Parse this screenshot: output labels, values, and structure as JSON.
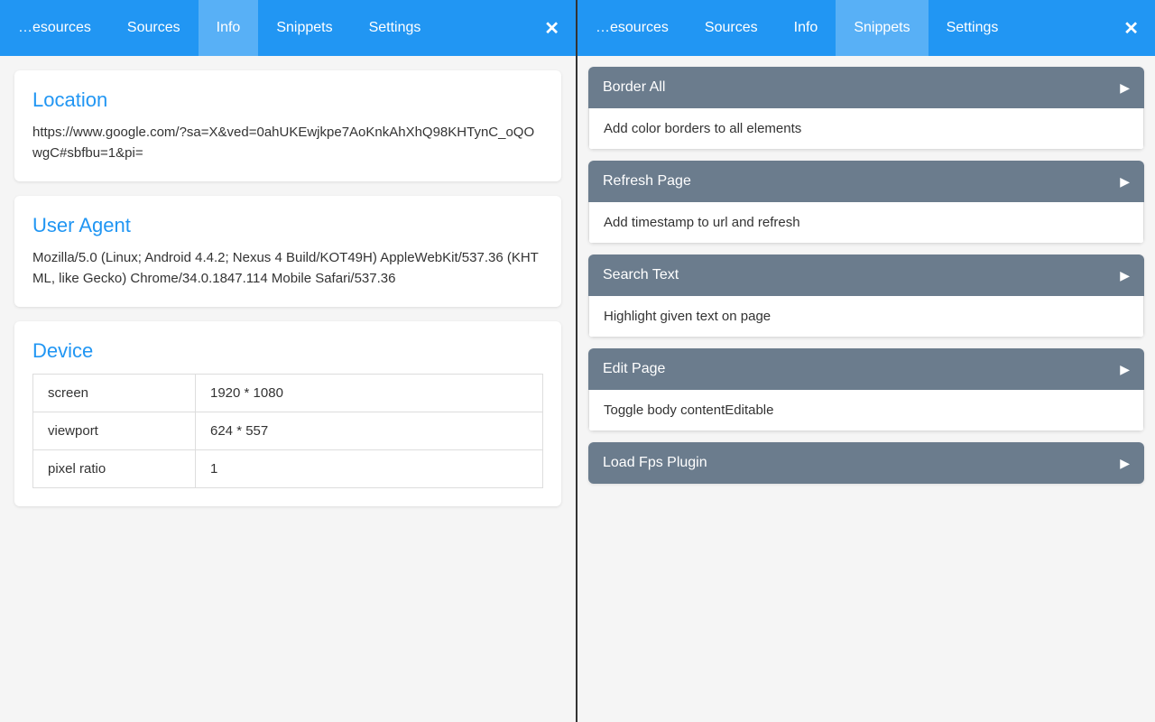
{
  "left_panel": {
    "tabs": [
      {
        "id": "resources",
        "label": "…esources"
      },
      {
        "id": "sources",
        "label": "Sources"
      },
      {
        "id": "info",
        "label": "Info",
        "active": true
      },
      {
        "id": "snippets",
        "label": "Snippets"
      },
      {
        "id": "settings",
        "label": "Settings"
      }
    ],
    "close_label": "✕",
    "location": {
      "title": "Location",
      "url": "https://www.google.com/?sa=X&ved=0ahUKEwjkpe7AoKnkAhXhQ98KHTynC_oQOwgC#sbfbu=1&pi="
    },
    "user_agent": {
      "title": "User Agent",
      "text": "Mozilla/5.0 (Linux; Android 4.4.2; Nexus 4 Build/KOT49H) AppleWebKit/537.36 (KHTML, like Gecko) Chrome/34.0.1847.114 Mobile Safari/537.36"
    },
    "device": {
      "title": "Device",
      "rows": [
        {
          "label": "screen",
          "value": "1920 * 1080"
        },
        {
          "label": "viewport",
          "value": "624 * 557"
        },
        {
          "label": "pixel ratio",
          "value": "1"
        }
      ]
    }
  },
  "right_panel": {
    "tabs": [
      {
        "id": "resources",
        "label": "…esources"
      },
      {
        "id": "sources",
        "label": "Sources"
      },
      {
        "id": "info",
        "label": "Info"
      },
      {
        "id": "snippets",
        "label": "Snippets",
        "active": true
      },
      {
        "id": "settings",
        "label": "Settings"
      }
    ],
    "close_label": "✕",
    "snippets": [
      {
        "id": "border-all",
        "title": "Border All",
        "description": "Add color borders to all elements"
      },
      {
        "id": "refresh-page",
        "title": "Refresh Page",
        "description": "Add timestamp to url and refresh"
      },
      {
        "id": "search-text",
        "title": "Search Text",
        "description": "Highlight given text on page"
      },
      {
        "id": "edit-page",
        "title": "Edit Page",
        "description": "Toggle body contentEditable"
      },
      {
        "id": "load-fps-plugin",
        "title": "Load Fps Plugin",
        "description": ""
      }
    ]
  }
}
